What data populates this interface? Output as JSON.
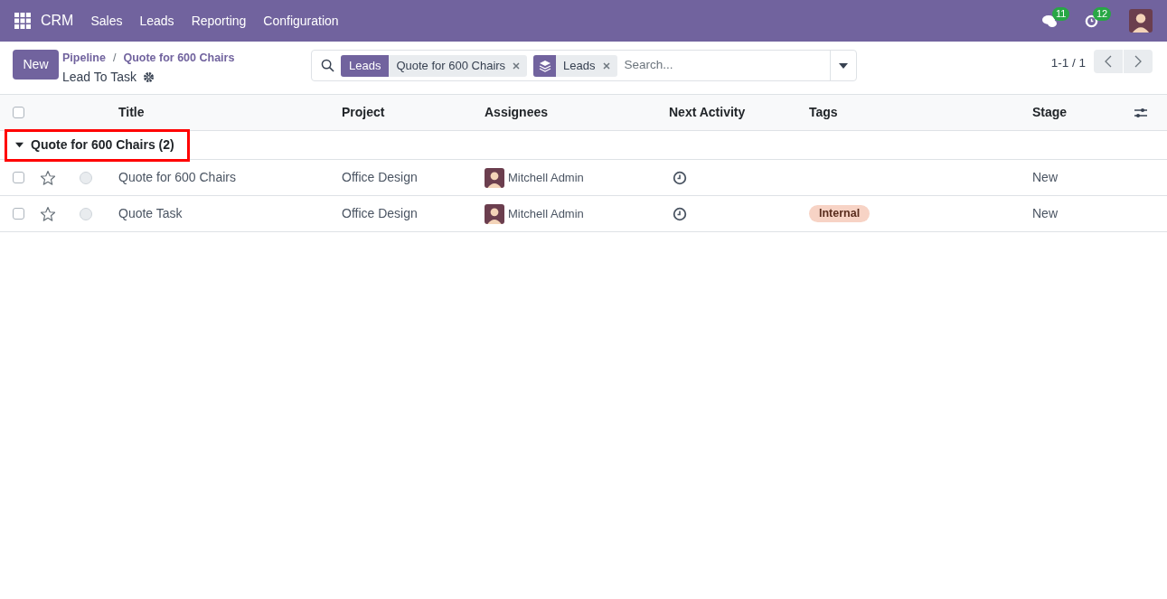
{
  "navbar": {
    "app": "CRM",
    "menu": [
      "Sales",
      "Leads",
      "Reporting",
      "Configuration"
    ],
    "messages_badge": "11",
    "activities_badge": "12"
  },
  "control_panel": {
    "new_button": "New",
    "breadcrumbs": [
      "Pipeline",
      "Quote for 600 Chairs"
    ],
    "breadcrumb_separator": "/",
    "title": "Lead To Task",
    "search": {
      "facets": [
        {
          "kind": "filter",
          "label": "Leads",
          "value": "Quote for 600 Chairs"
        },
        {
          "kind": "groupby",
          "value": "Leads"
        }
      ],
      "placeholder": "Search..."
    },
    "pager": "1-1 / 1"
  },
  "table": {
    "all_checked": false,
    "columns": [
      "Title",
      "Project",
      "Assignees",
      "Next Activity",
      "Tags",
      "Stage"
    ],
    "groups": [
      {
        "label": "Quote for 600 Chairs (2)",
        "expanded": true,
        "highlighted": true,
        "rows": [
          {
            "checked": false,
            "starred": false,
            "title": "Quote for 600 Chairs",
            "project": "Office Design",
            "assignee": "Mitchell Admin",
            "tags": [],
            "stage": "New"
          },
          {
            "checked": false,
            "starred": false,
            "title": "Quote Task",
            "project": "Office Design",
            "assignee": "Mitchell Admin",
            "tags": [
              "Internal"
            ],
            "stage": "New"
          }
        ]
      }
    ]
  }
}
